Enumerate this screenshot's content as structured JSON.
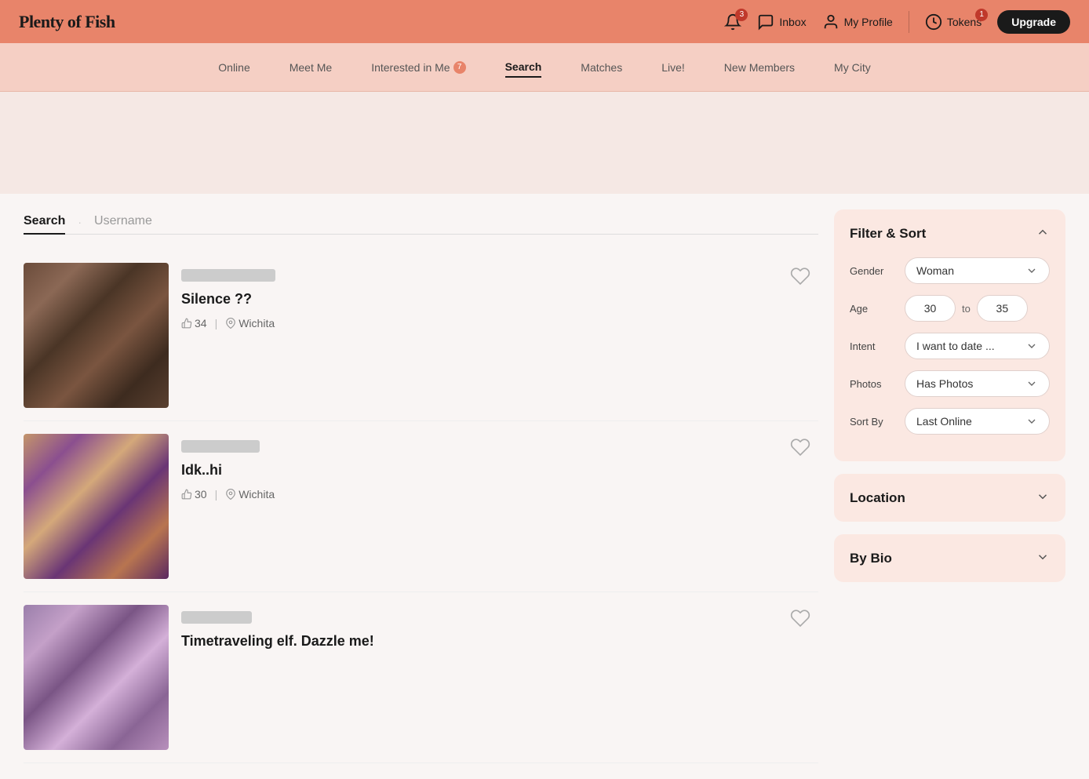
{
  "brand": {
    "name": "Plenty of Fish"
  },
  "header": {
    "notifications_badge": "3",
    "inbox_label": "Inbox",
    "profile_label": "My Profile",
    "tokens_label": "Tokens",
    "tokens_badge": "1",
    "upgrade_label": "Upgrade"
  },
  "nav": {
    "items": [
      {
        "label": "Online",
        "active": false
      },
      {
        "label": "Meet Me",
        "active": false
      },
      {
        "label": "Interested in Me",
        "active": false,
        "badge": "7"
      },
      {
        "label": "Search",
        "active": true
      },
      {
        "label": "Matches",
        "active": false
      },
      {
        "label": "Live!",
        "active": false
      },
      {
        "label": "New Members",
        "active": false
      },
      {
        "label": "My City",
        "active": false
      }
    ]
  },
  "search": {
    "tab_search_label": "Search",
    "tab_username_label": "Username"
  },
  "profiles": [
    {
      "display_name": "Silence ??",
      "age": "34",
      "location": "Wichita"
    },
    {
      "display_name": "Idk..hi",
      "age": "30",
      "location": "Wichita"
    },
    {
      "display_name": "Timetraveling elf. Dazzle me!",
      "age": "",
      "location": ""
    }
  ],
  "filters": {
    "title": "Filter & Sort",
    "gender_label": "Gender",
    "gender_value": "Woman",
    "age_label": "Age",
    "age_from": "30",
    "age_to": "35",
    "age_to_word": "to",
    "intent_label": "Intent",
    "intent_value": "I want to date ...",
    "photos_label": "Photos",
    "photos_value": "Has Photos",
    "sortby_label": "Sort By",
    "sortby_value": "Last Online"
  },
  "location": {
    "title": "Location"
  },
  "bybio": {
    "title": "By Bio"
  }
}
